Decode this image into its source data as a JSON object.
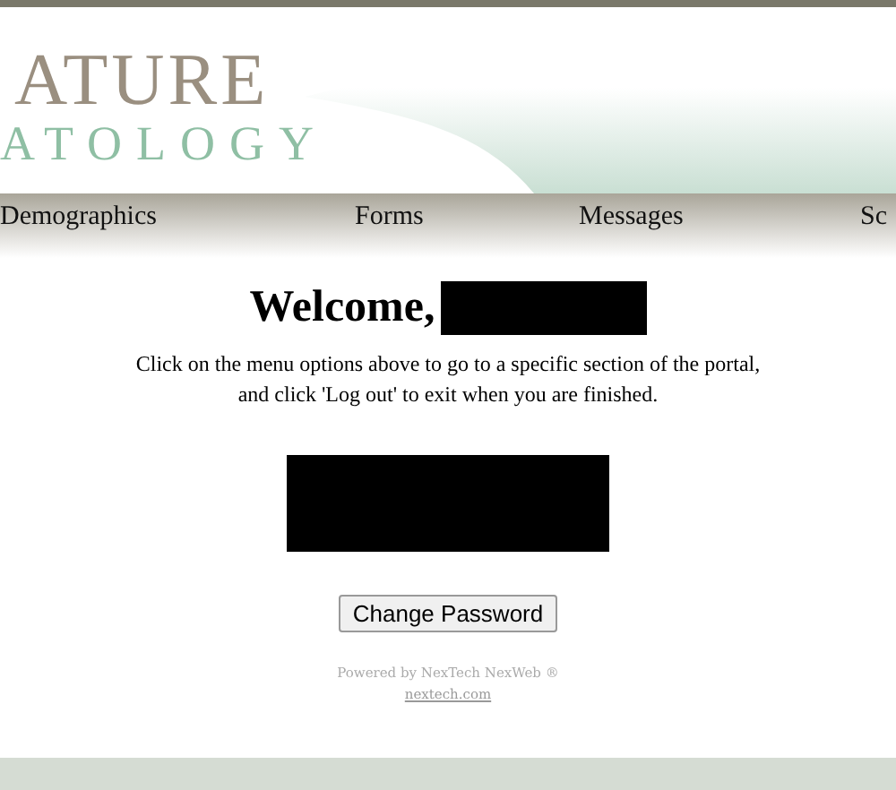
{
  "logo": {
    "line_1": "ATURE",
    "line_2": "ATOLOGY"
  },
  "nav": [
    {
      "label": "Demographics"
    },
    {
      "label": "Forms"
    },
    {
      "label": "Messages"
    },
    {
      "label": "Sc"
    }
  ],
  "welcome": {
    "heading": "Welcome,",
    "text_1": "Click on the menu options above to go to a specific section of the portal,",
    "text_2": "and click 'Log out' to exit when you are finished."
  },
  "button": "Change Password",
  "footer": {
    "powered": "Powered by NexTech NexWeb ®",
    "link": "nextech.com"
  }
}
